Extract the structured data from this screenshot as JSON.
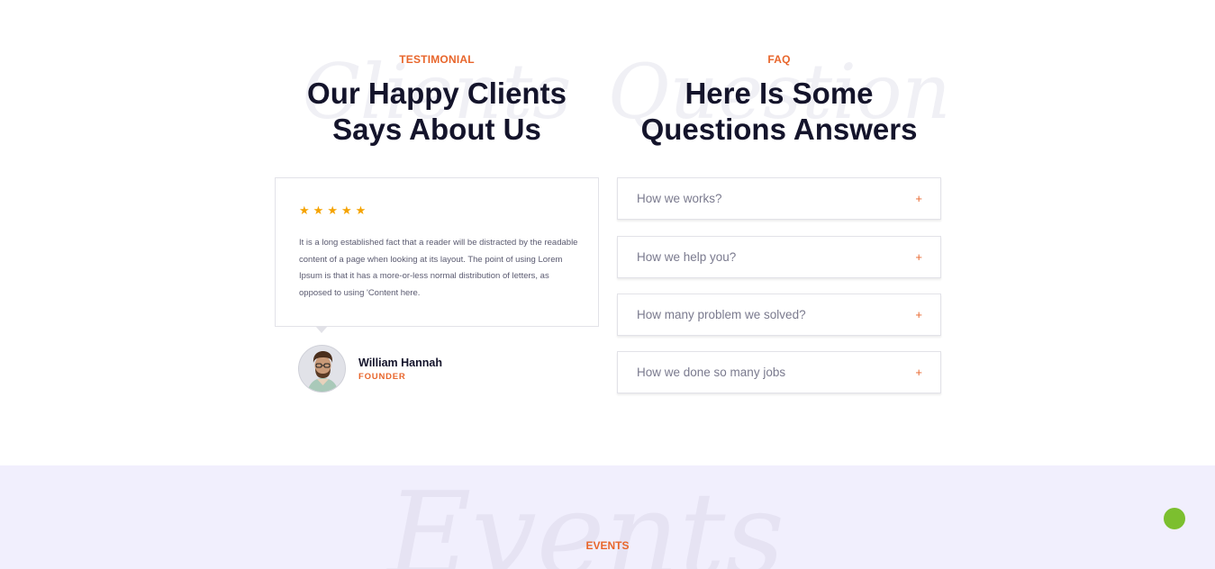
{
  "testimonial": {
    "eyebrow": "TESTIMONIAL",
    "watermark": "Clients",
    "heading_line1": "Our Happy Clients",
    "heading_line2": "Says About Us",
    "rating": 5,
    "quote": "It is a long established fact that a reader will be distracted by the readable content of a page when looking at its layout. The point of using Lorem Ipsum is that it has a more-or-less normal distribution of letters, as opposed to using 'Content here.",
    "author_name": "William Hannah",
    "author_role": "FOUNDER"
  },
  "faq": {
    "eyebrow": "FAQ",
    "watermark": "Question",
    "heading_line1": "Here Is Some",
    "heading_line2": "Questions Answers",
    "items": [
      {
        "question": "How we works?",
        "toggle": "+"
      },
      {
        "question": "How we help you?",
        "toggle": "+"
      },
      {
        "question": "How many problem we solved?",
        "toggle": "+"
      },
      {
        "question": "How we done so many jobs",
        "toggle": "+"
      }
    ]
  },
  "events": {
    "watermark": "Events",
    "eyebrow": "EVENTS"
  },
  "colors": {
    "accent": "#e8662c",
    "heading": "#14142b",
    "star": "#f5a300",
    "events_bg": "#f1effd",
    "scroll_button": "#7cbf2f"
  },
  "icons": {
    "star": "star-icon",
    "plus": "plus-icon"
  }
}
